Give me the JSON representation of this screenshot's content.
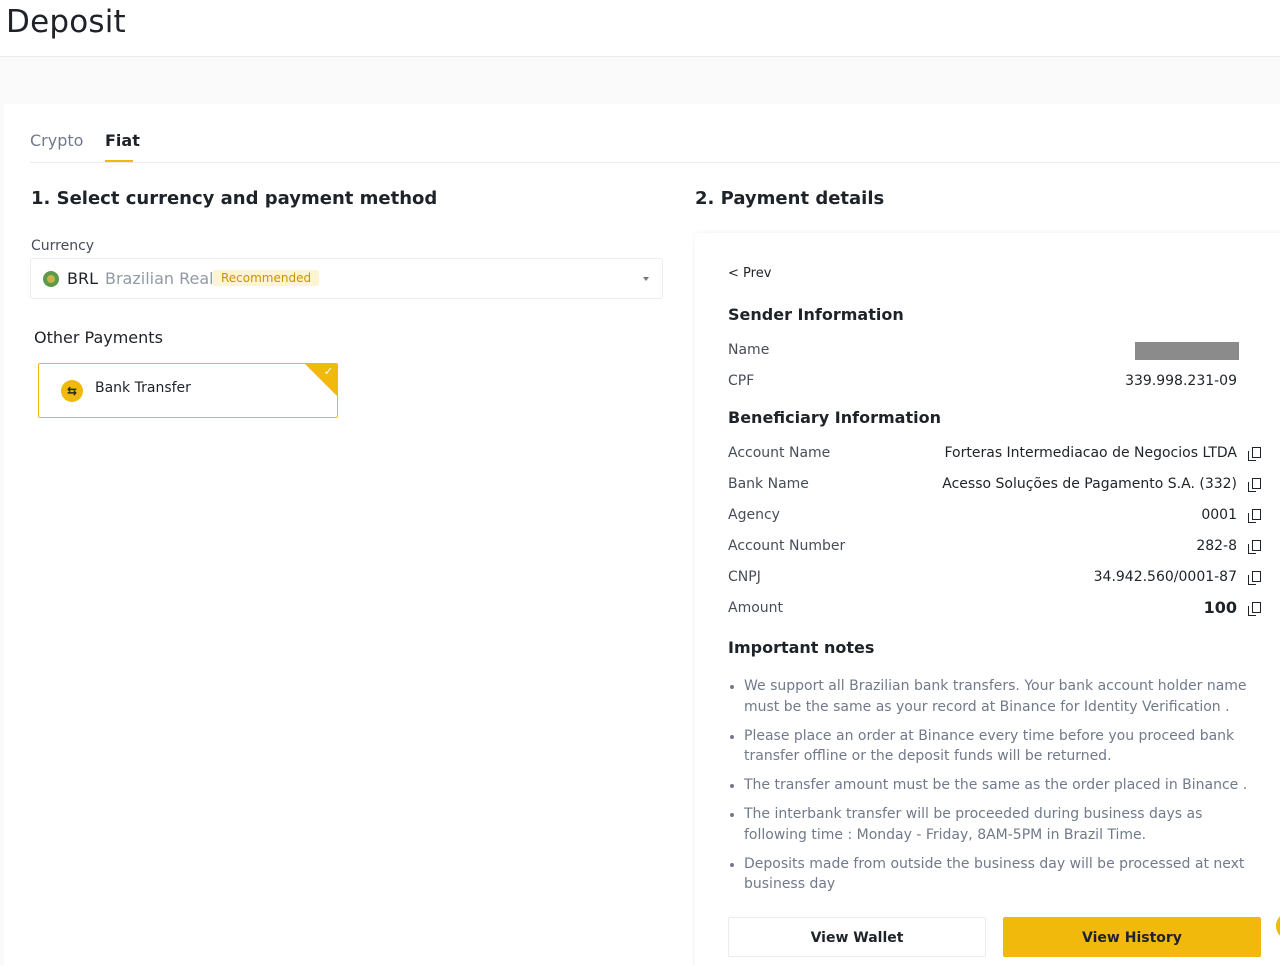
{
  "header": {
    "title": "Deposit"
  },
  "tabs": [
    {
      "label": "Crypto",
      "active": false
    },
    {
      "label": "Fiat",
      "active": true
    }
  ],
  "left": {
    "section_title": "1. Select currency and payment method",
    "currency_label": "Currency",
    "currency": {
      "code": "BRL",
      "name": "Brazilian Real",
      "badge": "Recommended"
    },
    "other_payments_label": "Other Payments",
    "payment_method": {
      "label": "Bank Transfer",
      "selected": true
    }
  },
  "right": {
    "section_title": "2. Payment details",
    "prev_label": "< Prev",
    "sender": {
      "title": "Sender Information",
      "rows": [
        {
          "label": "Name",
          "value": ""
        },
        {
          "label": "CPF",
          "value": "339.998.231-09"
        }
      ]
    },
    "beneficiary": {
      "title": "Beneficiary Information",
      "rows": [
        {
          "label": "Account Name",
          "value": "Forteras Intermediacao de Negocios LTDA"
        },
        {
          "label": "Bank Name",
          "value": "Acesso Soluções de Pagamento S.A. (332)"
        },
        {
          "label": "Agency",
          "value": "0001"
        },
        {
          "label": "Account Number",
          "value": "282-8"
        },
        {
          "label": "CNPJ",
          "value": "34.942.560/0001-87"
        },
        {
          "label": "Amount",
          "value": "100"
        }
      ]
    },
    "notes": {
      "title": "Important notes",
      "items": [
        "We support all Brazilian bank transfers. Your bank account holder name must be the same as your record at Binance for Identity Verification .",
        "Please place an order at Binance every time before you proceed bank transfer offline or the deposit funds will be returned.",
        "The transfer amount must be the same as the order placed in Binance .",
        "The interbank transfer will be proceeded during business days as following time : Monday - Friday, 8AM-5PM in Brazil Time.",
        "Deposits made from outside the business day will be processed at next business day"
      ]
    },
    "buttons": {
      "wallet": "View Wallet",
      "history": "View History"
    }
  },
  "colors": {
    "accent": "#f0b90b",
    "text": "#1e2329",
    "muted": "#707a8a"
  }
}
